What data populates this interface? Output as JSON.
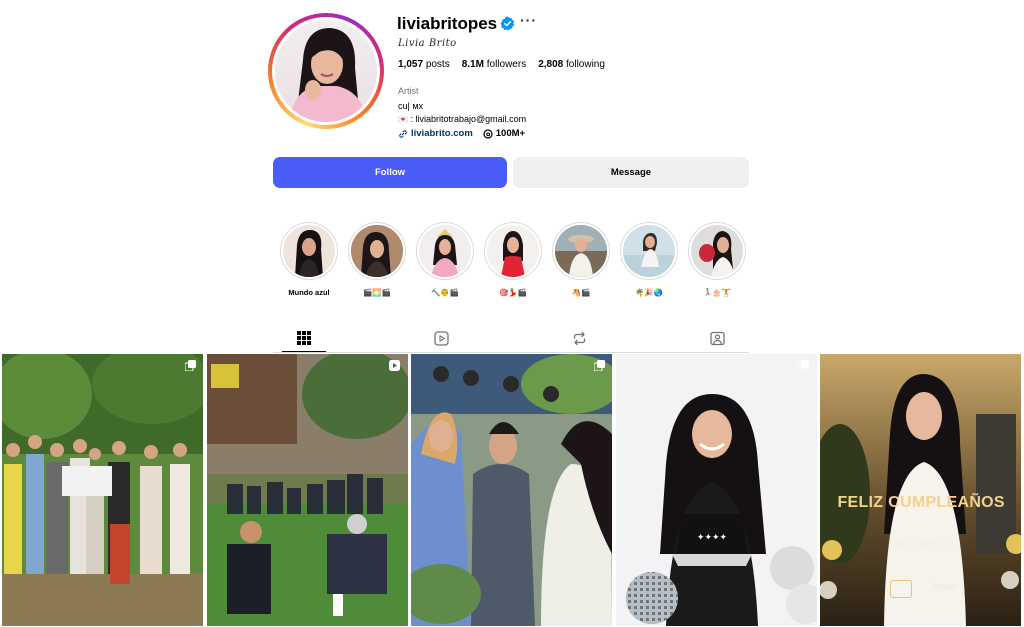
{
  "profile": {
    "username": "liviabritopes",
    "full_name": "Livia Brito",
    "verified": true,
    "stats": {
      "posts_value": "1,057",
      "posts_label": "posts",
      "followers_value": "8.1M",
      "followers_label": "followers",
      "following_value": "2,808",
      "following_label": "following"
    },
    "category": "Artist",
    "bio_line1": "cu| мx",
    "bio_line2": ": liviabritotrabajo@gmail.com",
    "link_text": "liviabrito.com",
    "threads_text": "100M+"
  },
  "actions": {
    "follow_label": "Follow",
    "message_label": "Message"
  },
  "highlights": [
    {
      "label": "Mundo azul"
    },
    {
      "label": "🎬🌅🎬"
    },
    {
      "label": "🔨🤴🎬"
    },
    {
      "label": "🎯💃🎬"
    },
    {
      "label": "🐴🎬"
    },
    {
      "label": "🌴🎉🌏"
    },
    {
      "label": "🏃🎂🏋"
    }
  ],
  "tabs": [
    {
      "name": "posts",
      "icon": "grid-icon",
      "active": true
    },
    {
      "name": "reels",
      "icon": "reels-icon",
      "active": false
    },
    {
      "name": "reposts",
      "icon": "repost-icon",
      "active": false
    },
    {
      "name": "tagged",
      "icon": "tagged-icon",
      "active": false
    }
  ],
  "posts": [
    {
      "badge": "carousel-icon"
    },
    {
      "badge": "reel-icon"
    },
    {
      "badge": "carousel-icon"
    },
    {
      "badge": "carousel-icon"
    },
    {
      "badge": "",
      "overlay_title": "FELIZ CUMPLEAÑOS",
      "overlay_name": "LIVIA BRITO",
      "logo_text": "Amor"
    }
  ],
  "colors": {
    "follow_button": "#4a5df9",
    "message_button": "#efefef",
    "link": "#00376b",
    "verified": "#0095f6"
  }
}
